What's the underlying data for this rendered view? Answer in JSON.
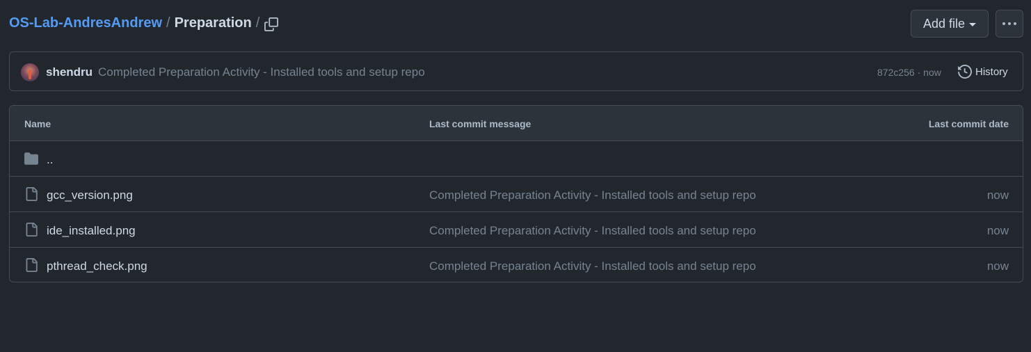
{
  "header": {
    "repo_link": "OS-Lab-AndresAndrew",
    "separator": "/",
    "current_dir": "Preparation",
    "trailing_separator": "/",
    "copy_icon": "copy-icon",
    "add_file_label": "Add file",
    "more_icon": "kebab-horizontal-icon"
  },
  "commit": {
    "author": "shendru",
    "message": "Completed Preparation Activity - Installed tools and setup repo",
    "meta": "872c256 · now",
    "history_label": "History",
    "history_icon": "history-icon"
  },
  "table": {
    "columns": {
      "name": "Name",
      "message": "Last commit message",
      "date": "Last commit date"
    },
    "parent_dir": "..",
    "rows": [
      {
        "name": "gcc_version.png",
        "message": "Completed Preparation Activity - Installed tools and setup repo",
        "date": "now"
      },
      {
        "name": "ide_installed.png",
        "message": "Completed Preparation Activity - Installed tools and setup repo",
        "date": "now"
      },
      {
        "name": "pthread_check.png",
        "message": "Completed Preparation Activity - Installed tools and setup repo",
        "date": "now"
      }
    ]
  },
  "colors": {
    "background": "#22272e",
    "link": "#539bf5",
    "border": "#444c56",
    "muted": "#768390"
  }
}
